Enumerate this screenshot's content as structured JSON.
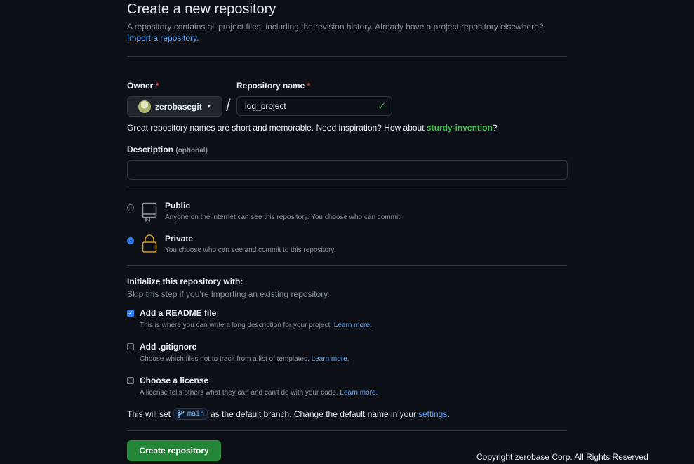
{
  "header": {
    "title": "Create a new repository",
    "subtitle": "A repository contains all project files, including the revision history. Already have a project repository elsewhere?",
    "import_link": "Import a repository."
  },
  "owner": {
    "label": "Owner",
    "required_mark": "*",
    "value": "zerobasegit"
  },
  "repo_name": {
    "label": "Repository name",
    "required_mark": "*",
    "value": "log_project",
    "separator": "/"
  },
  "suggestion": {
    "prefix": "Great repository names are short and memorable. Need inspiration? How about",
    "name": "sturdy-invention",
    "suffix": "?"
  },
  "description": {
    "label": "Description",
    "optional": "(optional)",
    "value": ""
  },
  "visibility": {
    "public": {
      "title": "Public",
      "subtitle": "Anyone on the internet can see this repository. You choose who can commit.",
      "selected": false
    },
    "private": {
      "title": "Private",
      "subtitle": "You choose who can see and commit to this repository.",
      "selected": true
    }
  },
  "init": {
    "title": "Initialize this repository with:",
    "subtitle": "Skip this step if you’re importing an existing repository.",
    "options": [
      {
        "title": "Add a README file",
        "subtitle": "This is where you can write a long description for your project.",
        "link": "Learn more.",
        "checked": true
      },
      {
        "title": "Add .gitignore",
        "subtitle": "Choose which files not to track from a list of templates.",
        "link": "Learn more.",
        "checked": false
      },
      {
        "title": "Choose a license",
        "subtitle": "A license tells others what they can and can't do with your code.",
        "link": "Learn more.",
        "checked": false
      }
    ]
  },
  "branch": {
    "prefix": "This will set",
    "name": "main",
    "middle": "as the default branch. Change the default name in your",
    "settings_link": "settings",
    "suffix": "."
  },
  "create_button": "Create repository",
  "footer": {
    "copyright": "Copyright zerobase Corp. All Rights Reserved"
  },
  "colors": {
    "background": "#0d1117",
    "accent_link": "#58a6ff",
    "success": "#3fb950",
    "primary_button": "#238636",
    "required": "#f85149",
    "private_icon": "#d29922"
  },
  "icons": {
    "public": "repo-icon",
    "private": "lock-icon",
    "branch": "git-branch-icon",
    "valid": "check-icon"
  }
}
